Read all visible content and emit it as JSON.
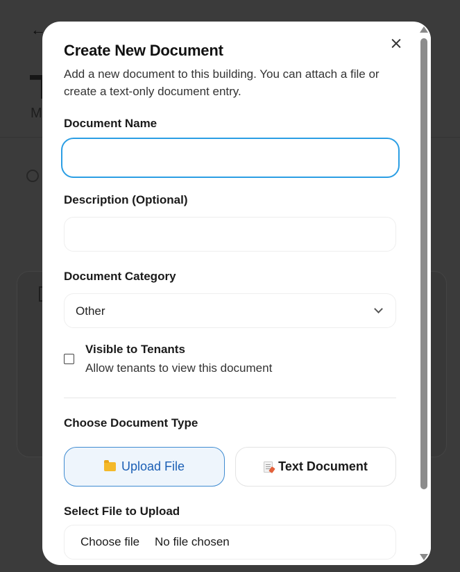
{
  "modal": {
    "title": "Create New Document",
    "description": "Add a new document to this building. You can attach a file or create a text-only document entry.",
    "close_icon": "close-icon"
  },
  "form": {
    "name_label": "Document Name",
    "name_value": "",
    "description_label": "Description (Optional)",
    "description_value": "",
    "category_label": "Document Category",
    "category_value": "Other",
    "visible_title": "Visible to Tenants",
    "visible_desc": "Allow tenants to view this document",
    "visible_checked": false,
    "type_label": "Choose Document Type",
    "type_options": [
      {
        "label": "Upload File",
        "icon": "folder-icon",
        "selected": true
      },
      {
        "label": "Text Document",
        "icon": "document-icon",
        "selected": false
      }
    ],
    "file_label": "Select File to Upload",
    "choose_file_label": "Choose file",
    "file_status": "No file chosen"
  },
  "colors": {
    "focus": "#2b9ee4",
    "selected_bg": "#eef5fc",
    "selected_text": "#1b5fb5",
    "overlay": "#3a3a3a"
  }
}
